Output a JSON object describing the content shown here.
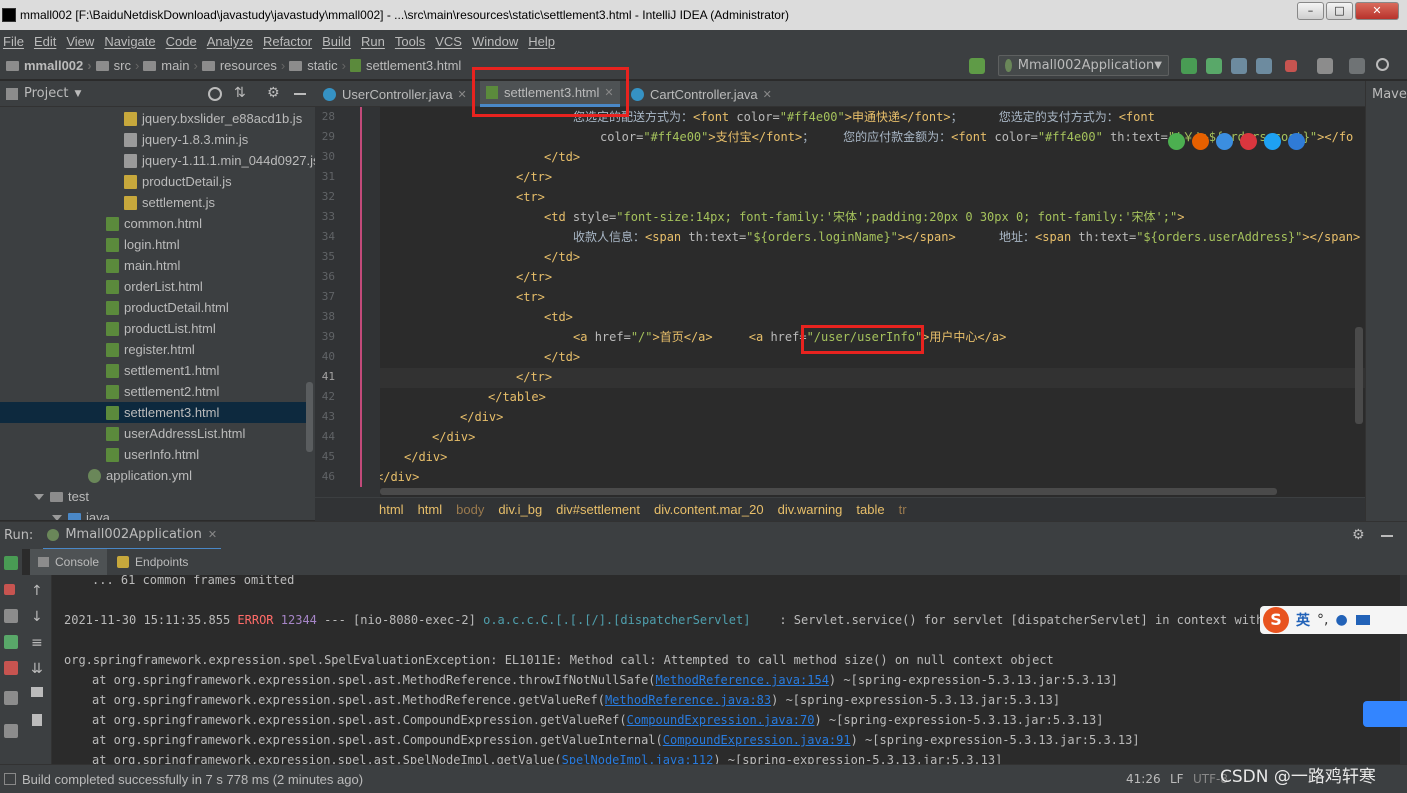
{
  "window": {
    "title": "mmall002 [F:\\BaiduNetdiskDownload\\javastudy\\javastudy\\mmall002] - ...\\src\\main\\resources\\static\\settlement3.html - IntelliJ IDEA (Administrator)",
    "controls": [
      "–",
      "□",
      "✕"
    ]
  },
  "menu": [
    "File",
    "Edit",
    "View",
    "Navigate",
    "Code",
    "Analyze",
    "Refactor",
    "Build",
    "Run",
    "Tools",
    "VCS",
    "Window",
    "Help"
  ],
  "breadcrumb": [
    "mmall002",
    "src",
    "main",
    "resources",
    "static",
    "settlement3.html"
  ],
  "run_config": "Mmall002Application",
  "project_panel": {
    "title": "Project",
    "items": [
      {
        "label": "jquery.bxslider_e88acd1b.js",
        "icon": "js"
      },
      {
        "label": "jquery-1.8.3.min.js",
        "icon": "txt"
      },
      {
        "label": "jquery-1.11.1.min_044d0927.js",
        "icon": "txt"
      },
      {
        "label": "productDetail.js",
        "icon": "js"
      },
      {
        "label": "settlement.js",
        "icon": "js"
      },
      {
        "label": "common.html",
        "icon": "html"
      },
      {
        "label": "login.html",
        "icon": "html"
      },
      {
        "label": "main.html",
        "icon": "html"
      },
      {
        "label": "orderList.html",
        "icon": "html"
      },
      {
        "label": "productDetail.html",
        "icon": "html"
      },
      {
        "label": "productList.html",
        "icon": "html"
      },
      {
        "label": "register.html",
        "icon": "html"
      },
      {
        "label": "settlement1.html",
        "icon": "html"
      },
      {
        "label": "settlement2.html",
        "icon": "html"
      },
      {
        "label": "settlement3.html",
        "icon": "html",
        "selected": true
      },
      {
        "label": "userAddressList.html",
        "icon": "html"
      },
      {
        "label": "userInfo.html",
        "icon": "html"
      },
      {
        "label": "application.yml",
        "icon": "yml"
      },
      {
        "label": "test",
        "icon": "folder"
      },
      {
        "label": "java",
        "icon": "folder"
      }
    ]
  },
  "tabs": [
    {
      "label": "UserController.java",
      "type": "java"
    },
    {
      "label": "settlement3.html",
      "type": "html",
      "active": true
    },
    {
      "label": "CartController.java",
      "type": "java"
    }
  ],
  "right_stripe_label": "Mave",
  "editor": {
    "line_numbers": [
      "28",
      "29",
      "30",
      "31",
      "32",
      "33",
      "34",
      "35",
      "36",
      "37",
      "38",
      "39",
      "40",
      "41",
      "42",
      "43",
      "44",
      "45",
      "46"
    ],
    "current_line": "41",
    "code": {
      "l28a": "您选定的配送方式为：",
      "l28b": "<font ",
      "l28c": "color=",
      "l28d": "\"#ff4e00\"",
      "l28e": ">申通快递",
      "l28f": "</font>",
      "l28g": "；     您选定的支付方式为：",
      "l28h": "<font",
      "l29a": "color=",
      "l29b": "\"#ff4e00\"",
      "l29c": ">支付宝",
      "l29d": "</font>",
      "l29e": "；    您的应付款金额为：",
      "l29f": "<font ",
      "l29g": "color=",
      "l29h": "\"#ff4e00\" ",
      "l29i": "th:text=",
      "l29j": "\"'￥'+${orders.cost}\"",
      "l29k": "></fo",
      "l30": "</td>",
      "l31": "</tr>",
      "l32": "<tr>",
      "l33a": "<td ",
      "l33b": "style=",
      "l33c": "\"font-size:14px; font-family:'宋体';padding:20px 0 30px 0; font-family:'宋体';\"",
      "l33d": ">",
      "l34a": "收款人信息：",
      "l34b": "<span ",
      "l34c": "th:text=",
      "l34d": "\"${orders.loginName}\"",
      "l34e": "></span>",
      "l34f": "      地址：",
      "l34g": "<span ",
      "l34h": "th:text=",
      "l34i": "\"${orders.userAddress}\"",
      "l34j": "></span>",
      "l35": "</td>",
      "l36": "</tr>",
      "l37": "<tr>",
      "l38": "<td>",
      "l39a": "<a ",
      "l39b": "href=",
      "l39c": "\"/\"",
      "l39d": ">首页",
      "l39e": "</a>",
      "l39f": "     ",
      "l39g": "<a ",
      "l39h": "href=",
      "l39i": "\"/user/userInfo\"",
      "l39j": ">用户中心",
      "l39k": "</a>",
      "l40": "</td>",
      "l41": "</tr>",
      "l42": "</table>",
      "l43": "</div>",
      "l44": "</div>",
      "l45": "</div>",
      "l46": "</div>"
    }
  },
  "editor_breadcrumb": [
    "html",
    "html",
    "body",
    "div.i_bg",
    "div#settlement",
    "div.content.mar_20",
    "div.warning",
    "table",
    "tr"
  ],
  "run_panel": {
    "label": "Run:",
    "app_tab": "Mmall002Application",
    "subtabs": [
      "Console",
      "Endpoints"
    ],
    "console": {
      "omitted": "... 61 common frames omitted",
      "log_ts": "2021-11-30 15:11:35.855",
      "log_level": "ERROR",
      "log_pid": "12344",
      "log_sep": "---",
      "log_thread": "[nio-8080-exec-2]",
      "log_logger": "o.a.c.c.C.[.[.[/].[dispatcherServlet]",
      "log_msg": "   : Servlet.service() for servlet [dispatcherServlet] in context with path",
      "exception": "org.springframework.expression.spel.SpelEvaluationException: EL1011E: Method call: Attempted to call method size() on null context object",
      "frames": [
        {
          "pre": "at org.springframework.expression.spel.ast.MethodReference.throwIfNotNullSafe(",
          "link": "MethodReference.java:154",
          "post": ") ~[spring-expression-5.3.13.jar:5.3.13]"
        },
        {
          "pre": "at org.springframework.expression.spel.ast.MethodReference.getValueRef(",
          "link": "MethodReference.java:83",
          "post": ") ~[spring-expression-5.3.13.jar:5.3.13]"
        },
        {
          "pre": "at org.springframework.expression.spel.ast.CompoundExpression.getValueRef(",
          "link": "CompoundExpression.java:70",
          "post": ") ~[spring-expression-5.3.13.jar:5.3.13]"
        },
        {
          "pre": "at org.springframework.expression.spel.ast.CompoundExpression.getValueInternal(",
          "link": "CompoundExpression.java:91",
          "post": ") ~[spring-expression-5.3.13.jar:5.3.13]"
        },
        {
          "pre": "at org.springframework.expression.spel.ast.SpelNodeImpl.getValue(",
          "link": "SpelNodeImpl.java:112",
          "post": ") ~[spring-expression-5.3.13.jar:5.3.13]"
        }
      ]
    }
  },
  "ime": {
    "lang": "英"
  },
  "status": {
    "message": "Build completed successfully in 7 s 778 ms (2 minutes ago)",
    "position": "41:26",
    "line_sep": "LF",
    "encoding": "UTF-8"
  },
  "watermark": "CSDN @一路鸡轩寒",
  "colors": {
    "highlight": "#e8231f",
    "accent": "#4a88c7"
  }
}
